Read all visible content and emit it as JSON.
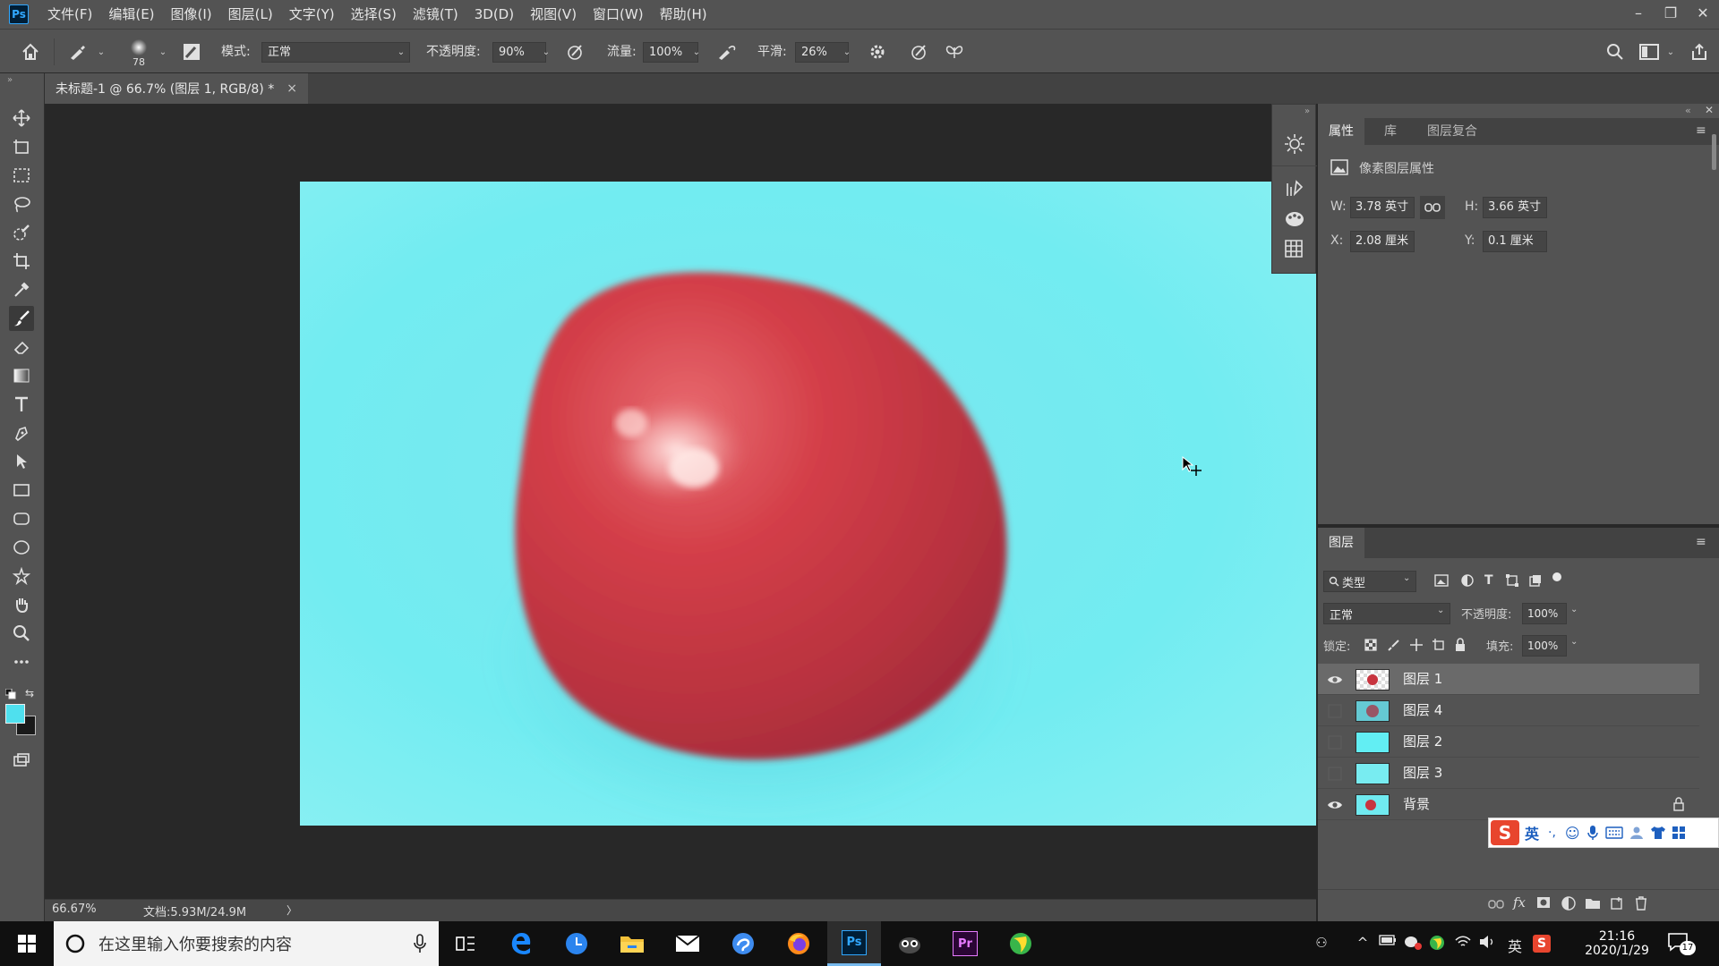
{
  "app": {
    "logo": "Ps"
  },
  "menu": [
    "文件(F)",
    "编辑(E)",
    "图像(I)",
    "图层(L)",
    "文字(Y)",
    "选择(S)",
    "滤镜(T)",
    "3D(D)",
    "视图(V)",
    "窗口(W)",
    "帮助(H)"
  ],
  "window_controls": {
    "minimize": "–",
    "restore": "❐",
    "close": "✕"
  },
  "options": {
    "brush_size": "78",
    "mode_label": "模式:",
    "mode_value": "正常",
    "opacity_label": "不透明度:",
    "opacity_value": "90%",
    "flow_label": "流量:",
    "flow_value": "100%",
    "smoothing_label": "平滑:",
    "smoothing_value": "26%"
  },
  "document": {
    "tab_title": "未标题-1 @ 66.7% (图层 1, RGB/8) *",
    "close": "×"
  },
  "colors": {
    "foreground": "#4fe0ee",
    "background": "#1a1a1a",
    "canvas_bg": "#6feaf0",
    "apple": "#c8343f"
  },
  "properties": {
    "tabs": [
      "属性",
      "库",
      "图层复合"
    ],
    "section_title": "像素图层属性",
    "w_label": "W:",
    "w_value": "3.78 英寸",
    "h_label": "H:",
    "h_value": "3.66 英寸",
    "x_label": "X:",
    "x_value": "2.08 厘米",
    "y_label": "Y:",
    "y_value": "0.1 厘米"
  },
  "layers": {
    "title": "图层",
    "filter_kind": "类型",
    "blend_mode": "正常",
    "opacity_label": "不透明度:",
    "opacity_value": "100%",
    "lock_label": "锁定:",
    "fill_label": "填充:",
    "fill_value": "100%",
    "items": [
      {
        "name": "图层 1",
        "visible": true,
        "selected": true,
        "thumb": "apple-transparent"
      },
      {
        "name": "图层 4",
        "visible": false,
        "selected": false,
        "thumb": "apple-cyan"
      },
      {
        "name": "图层 2",
        "visible": false,
        "selected": false,
        "thumb": "cyan"
      },
      {
        "name": "图层 3",
        "visible": false,
        "selected": false,
        "thumb": "cyan"
      },
      {
        "name": "背景",
        "visible": true,
        "selected": false,
        "thumb": "apple-cyan",
        "locked": true
      }
    ]
  },
  "status": {
    "zoom": "66.67%",
    "doc_size": "文档:5.93M/24.9M",
    "arrow": "〉"
  },
  "ime": {
    "lang": "英",
    "punct": "·,"
  },
  "taskbar": {
    "search_placeholder": "在这里输入你要搜索的内容",
    "tray_lang": "英",
    "time": "21:16",
    "date": "2020/1/29",
    "notification_count": "17",
    "ps_label": "Ps",
    "pr_label": "Pr"
  }
}
